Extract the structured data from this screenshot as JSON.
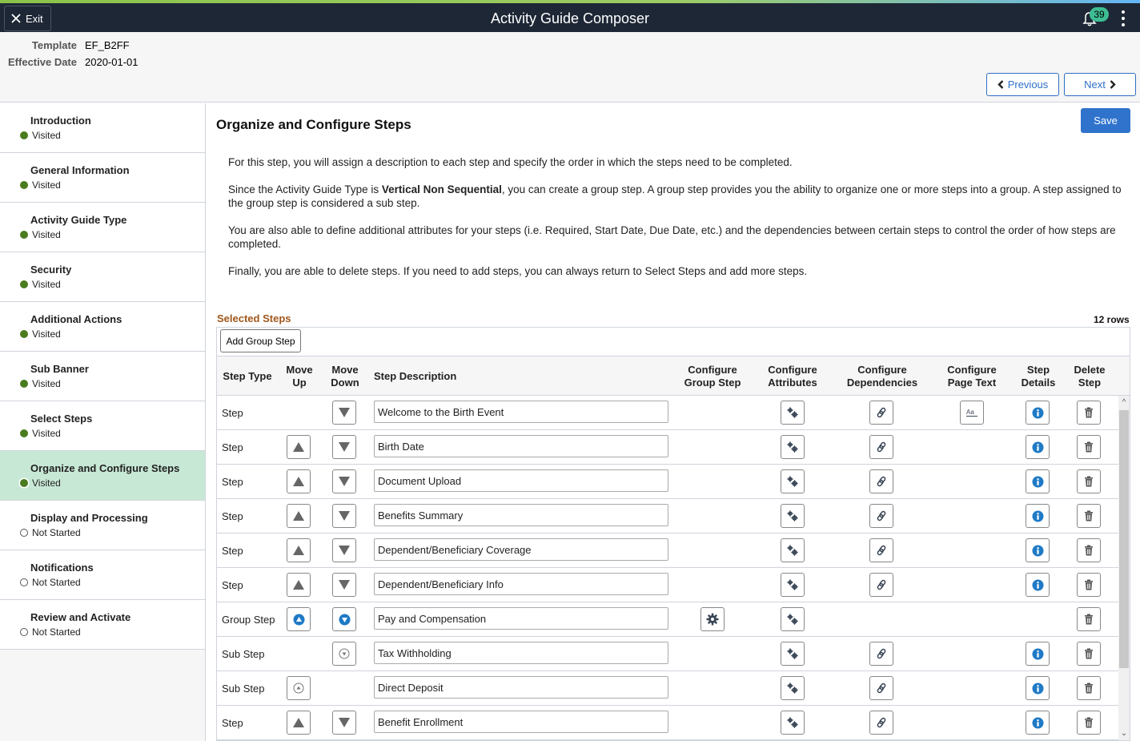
{
  "banner": {
    "exit_label": "Exit",
    "title": "Activity Guide Composer",
    "notification_count": "39"
  },
  "header": {
    "template_label": "Template",
    "template_value": "EF_B2FF",
    "effdate_label": "Effective Date",
    "effdate_value": "2020-01-01",
    "previous_label": "Previous",
    "next_label": "Next"
  },
  "sidebar": {
    "items": [
      {
        "title": "Introduction",
        "status": "Visited",
        "state": "visited"
      },
      {
        "title": "General Information",
        "status": "Visited",
        "state": "visited"
      },
      {
        "title": "Activity Guide Type",
        "status": "Visited",
        "state": "visited"
      },
      {
        "title": "Security",
        "status": "Visited",
        "state": "visited"
      },
      {
        "title": "Additional Actions",
        "status": "Visited",
        "state": "visited"
      },
      {
        "title": "Sub Banner",
        "status": "Visited",
        "state": "visited"
      },
      {
        "title": "Select Steps",
        "status": "Visited",
        "state": "visited"
      },
      {
        "title": "Organize and Configure Steps",
        "status": "Visited",
        "state": "visited",
        "active": true
      },
      {
        "title": "Display and Processing",
        "status": "Not Started",
        "state": "not-started"
      },
      {
        "title": "Notifications",
        "status": "Not Started",
        "state": "not-started"
      },
      {
        "title": "Review and Activate",
        "status": "Not Started",
        "state": "not-started"
      }
    ]
  },
  "main": {
    "title": "Organize and Configure Steps",
    "save_label": "Save",
    "intro": {
      "p1": "For this step, you will assign a description to each step and specify the order in which the steps need to be completed.",
      "p2_before": "Since the Activity Guide Type is ",
      "p2_bold": "Vertical Non Sequential",
      "p2_after": ", you can create a group step. A group step provides you the ability to organize one or more steps into a group. A step assigned to the group step is considered a sub step.",
      "p3": "You are also able to define additional attributes for your steps (i.e. Required, Start Date, Due Date, etc.) and the dependencies between certain steps to control the order of how steps are completed.",
      "p4": "Finally, you are able to delete steps. If you need to add steps, you can always return to Select Steps and add more steps."
    },
    "section_title": "Selected Steps",
    "row_count": "12 rows",
    "add_group_label": "Add Group Step",
    "columns": {
      "step_type": "Step Type",
      "move_up": "Move Up",
      "move_down": "Move Down",
      "step_description": "Step Description",
      "configure_group": "Configure Group Step",
      "configure_attributes": "Configure Attributes",
      "configure_dependencies": "Configure Dependencies",
      "configure_page_text": "Configure Page Text",
      "step_details": "Step Details",
      "delete_step": "Delete Step"
    },
    "rows": [
      {
        "type": "Step",
        "up": "none",
        "down": "arrow",
        "desc": "Welcome to the Birth Event",
        "group": false,
        "attr": true,
        "dep": true,
        "page": true,
        "details": true,
        "del": true
      },
      {
        "type": "Step",
        "up": "arrow",
        "down": "arrow",
        "desc": "Birth Date",
        "group": false,
        "attr": true,
        "dep": true,
        "page": false,
        "details": true,
        "del": true
      },
      {
        "type": "Step",
        "up": "arrow",
        "down": "arrow",
        "desc": "Document Upload",
        "group": false,
        "attr": true,
        "dep": true,
        "page": false,
        "details": true,
        "del": true
      },
      {
        "type": "Step",
        "up": "arrow",
        "down": "arrow",
        "desc": "Benefits Summary",
        "group": false,
        "attr": true,
        "dep": true,
        "page": false,
        "details": true,
        "del": true
      },
      {
        "type": "Step",
        "up": "arrow",
        "down": "arrow",
        "desc": "Dependent/Beneficiary Coverage",
        "group": false,
        "attr": true,
        "dep": true,
        "page": false,
        "details": true,
        "del": true
      },
      {
        "type": "Step",
        "up": "arrow",
        "down": "arrow",
        "desc": "Dependent/Beneficiary Info",
        "group": false,
        "attr": true,
        "dep": true,
        "page": false,
        "details": true,
        "del": true
      },
      {
        "type": "Group Step",
        "up": "group",
        "down": "group",
        "desc": "Pay and Compensation",
        "group": true,
        "attr": true,
        "dep": false,
        "page": false,
        "details": false,
        "del": true
      },
      {
        "type": "Sub Step",
        "up": "none",
        "down": "sub",
        "desc": "Tax Withholding",
        "group": false,
        "attr": true,
        "dep": true,
        "page": false,
        "details": true,
        "del": true
      },
      {
        "type": "Sub Step",
        "up": "sub",
        "down": "none",
        "desc": "Direct Deposit",
        "group": false,
        "attr": true,
        "dep": true,
        "page": false,
        "details": true,
        "del": true
      },
      {
        "type": "Step",
        "up": "arrow",
        "down": "arrow",
        "desc": "Benefit Enrollment",
        "group": false,
        "attr": true,
        "dep": true,
        "page": false,
        "details": true,
        "del": true
      }
    ]
  },
  "colors": {
    "banner_bg": "#1e2735",
    "accent_blue": "#2f73cc",
    "visited_green": "#4a7b1f",
    "active_bg": "#c8e8d6",
    "section_title": "#a0561a",
    "badge": "#3ebd93"
  }
}
